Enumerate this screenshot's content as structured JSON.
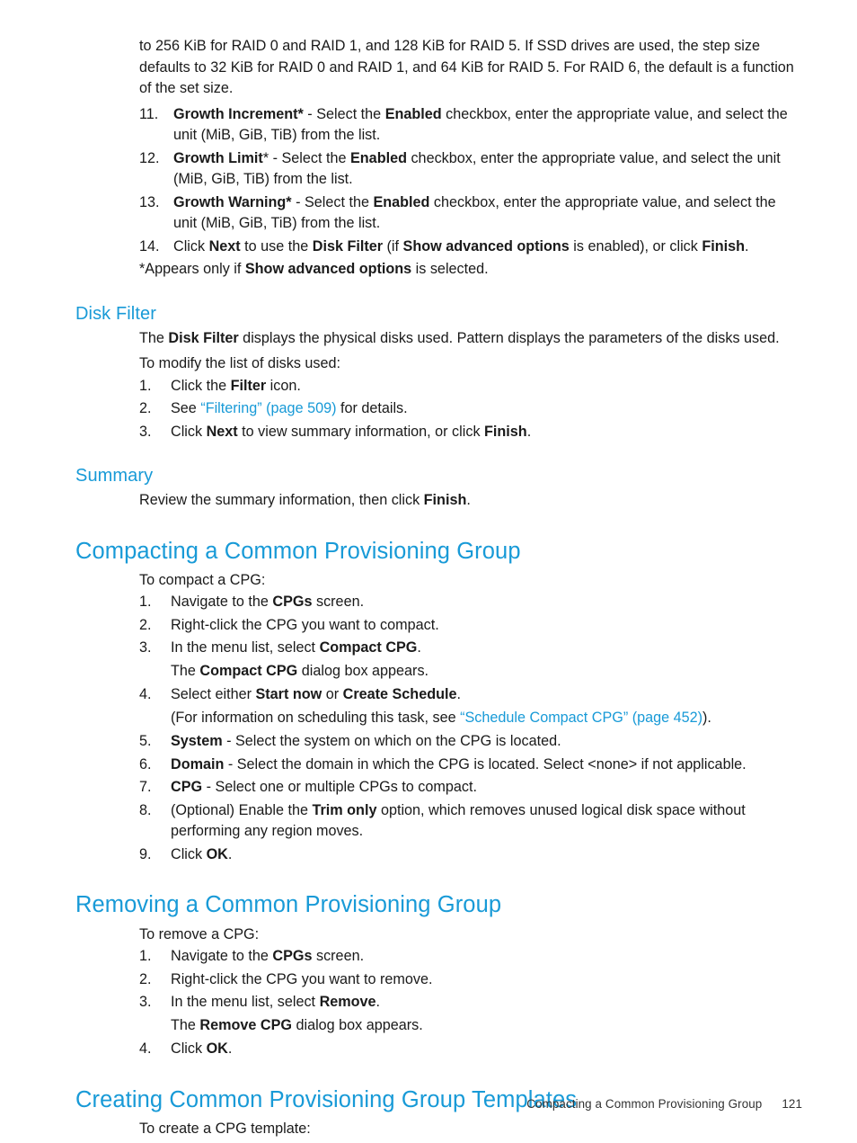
{
  "page": {
    "footer_title": "Compacting a Common Provisioning Group",
    "footer_page_number": "121",
    "accent_color": "#189ad7",
    "text_color": "#1a1a1a"
  },
  "intro": {
    "continuation_paragraph": "to 256 KiB for RAID 0 and RAID 1, and 128 KiB for RAID 5. If SSD drives are used, the step size defaults to 32 KiB for RAID 0 and RAID 1, and 64 KiB for RAID 5. For RAID 6, the default is a function of the set size."
  },
  "numbered_steps_continued": [
    {
      "num": "11.",
      "parts": [
        {
          "text": "Growth Increment*",
          "bold": true
        },
        {
          "text": " - Select the ",
          "bold": false
        },
        {
          "text": "Enabled",
          "bold": true
        },
        {
          "text": " checkbox, enter the appropriate value, and select the unit (MiB, GiB, TiB) from the list.",
          "bold": false
        }
      ]
    },
    {
      "num": "12.",
      "parts": [
        {
          "text": "Growth Limit",
          "bold": true
        },
        {
          "text": "* - Select the ",
          "bold": false
        },
        {
          "text": "Enabled",
          "bold": true
        },
        {
          "text": " checkbox, enter the appropriate value, and select the unit (MiB, GiB, TiB) from the list.",
          "bold": false
        }
      ]
    },
    {
      "num": "13.",
      "parts": [
        {
          "text": "Growth Warning*",
          "bold": true
        },
        {
          "text": " - Select the ",
          "bold": false
        },
        {
          "text": "Enabled",
          "bold": true
        },
        {
          "text": " checkbox, enter the appropriate value, and select the unit (MiB, GiB, TiB) from the list.",
          "bold": false
        }
      ]
    },
    {
      "num": "14.",
      "parts": [
        {
          "text": "Click ",
          "bold": false
        },
        {
          "text": "Next",
          "bold": true
        },
        {
          "text": " to use the ",
          "bold": false
        },
        {
          "text": "Disk Filter",
          "bold": true
        },
        {
          "text": " (if ",
          "bold": false
        },
        {
          "text": "Show advanced options",
          "bold": true
        },
        {
          "text": " is enabled), or click ",
          "bold": false
        },
        {
          "text": "Finish",
          "bold": true
        },
        {
          "text": ".",
          "bold": false
        }
      ]
    }
  ],
  "footnote": {
    "prefix": "*Appears only if ",
    "bold": "Show advanced options",
    "suffix": " is selected."
  },
  "disk_filter": {
    "heading": "Disk Filter",
    "intro_parts": [
      {
        "text": "The ",
        "bold": false
      },
      {
        "text": "Disk Filter",
        "bold": true
      },
      {
        "text": " displays the physical disks used. Pattern displays the parameters of the disks used.",
        "bold": false
      }
    ],
    "lead_in": "To modify the list of disks used:",
    "steps": [
      {
        "num": "1.",
        "parts": [
          {
            "text": "Click the ",
            "bold": false
          },
          {
            "text": "Filter",
            "bold": true
          },
          {
            "text": " icon.",
            "bold": false
          }
        ]
      },
      {
        "num": "2.",
        "parts": [
          {
            "text": "See ",
            "bold": false
          },
          {
            "text": "“Filtering” (page 509)",
            "link": true
          },
          {
            "text": " for details.",
            "bold": false
          }
        ]
      },
      {
        "num": "3.",
        "parts": [
          {
            "text": "Click ",
            "bold": false
          },
          {
            "text": "Next",
            "bold": true
          },
          {
            "text": " to view summary information, or click ",
            "bold": false
          },
          {
            "text": "Finish",
            "bold": true
          },
          {
            "text": ".",
            "bold": false
          }
        ]
      }
    ]
  },
  "summary": {
    "heading": "Summary",
    "parts": [
      {
        "text": "Review the summary information, then click ",
        "bold": false
      },
      {
        "text": "Finish",
        "bold": true
      },
      {
        "text": ".",
        "bold": false
      }
    ]
  },
  "compacting": {
    "heading": "Compacting a Common Provisioning Group",
    "lead_in": "To compact a CPG:",
    "steps": [
      {
        "num": "1.",
        "parts": [
          {
            "text": "Navigate to the ",
            "bold": false
          },
          {
            "text": "CPGs",
            "bold": true
          },
          {
            "text": " screen.",
            "bold": false
          }
        ]
      },
      {
        "num": "2.",
        "parts": [
          {
            "text": "Right-click the CPG you want to compact.",
            "bold": false
          }
        ]
      },
      {
        "num": "3.",
        "parts": [
          {
            "text": "In the menu list, select ",
            "bold": false
          },
          {
            "text": "Compact CPG",
            "bold": true
          },
          {
            "text": ".",
            "bold": false
          }
        ],
        "note_parts": [
          {
            "text": "The ",
            "bold": false
          },
          {
            "text": "Compact CPG",
            "bold": true
          },
          {
            "text": " dialog box appears.",
            "bold": false
          }
        ]
      },
      {
        "num": "4.",
        "parts": [
          {
            "text": "Select either ",
            "bold": false
          },
          {
            "text": "Start now",
            "bold": true
          },
          {
            "text": " or ",
            "bold": false
          },
          {
            "text": "Create Schedule",
            "bold": true
          },
          {
            "text": ".",
            "bold": false
          }
        ],
        "note_parts": [
          {
            "text": "(For information on scheduling this task, see ",
            "bold": false
          },
          {
            "text": "“Schedule Compact CPG” (page 452)",
            "link": true
          },
          {
            "text": ").",
            "bold": false
          }
        ]
      },
      {
        "num": "5.",
        "parts": [
          {
            "text": "System",
            "bold": true
          },
          {
            "text": " - Select the system on which on the CPG is located.",
            "bold": false
          }
        ]
      },
      {
        "num": "6.",
        "parts": [
          {
            "text": "Domain",
            "bold": true
          },
          {
            "text": " - Select the domain in which the CPG is located. Select <none> if not applicable.",
            "bold": false
          }
        ]
      },
      {
        "num": "7.",
        "parts": [
          {
            "text": "CPG",
            "bold": true
          },
          {
            "text": " - Select one or multiple CPGs to compact.",
            "bold": false
          }
        ]
      },
      {
        "num": "8.",
        "parts": [
          {
            "text": "(Optional) Enable the ",
            "bold": false
          },
          {
            "text": "Trim only",
            "bold": true
          },
          {
            "text": " option, which removes unused logical disk space without performing any region moves.",
            "bold": false
          }
        ]
      },
      {
        "num": "9.",
        "parts": [
          {
            "text": "Click ",
            "bold": false
          },
          {
            "text": "OK",
            "bold": true
          },
          {
            "text": ".",
            "bold": false
          }
        ]
      }
    ]
  },
  "removing": {
    "heading": "Removing a Common Provisioning Group",
    "lead_in": "To remove a CPG:",
    "steps": [
      {
        "num": "1.",
        "parts": [
          {
            "text": "Navigate to the ",
            "bold": false
          },
          {
            "text": "CPGs",
            "bold": true
          },
          {
            "text": " screen.",
            "bold": false
          }
        ]
      },
      {
        "num": "2.",
        "parts": [
          {
            "text": "Right-click the CPG you want to remove.",
            "bold": false
          }
        ]
      },
      {
        "num": "3.",
        "parts": [
          {
            "text": "In the menu list, select ",
            "bold": false
          },
          {
            "text": "Remove",
            "bold": true
          },
          {
            "text": ".",
            "bold": false
          }
        ],
        "note_parts": [
          {
            "text": "The ",
            "bold": false
          },
          {
            "text": "Remove CPG",
            "bold": true
          },
          {
            "text": " dialog box appears.",
            "bold": false
          }
        ]
      },
      {
        "num": "4.",
        "parts": [
          {
            "text": "Click ",
            "bold": false
          },
          {
            "text": "OK",
            "bold": true
          },
          {
            "text": ".",
            "bold": false
          }
        ]
      }
    ]
  },
  "creating_templates": {
    "heading": "Creating Common Provisioning Group Templates",
    "lead_in": "To create a CPG template:"
  }
}
